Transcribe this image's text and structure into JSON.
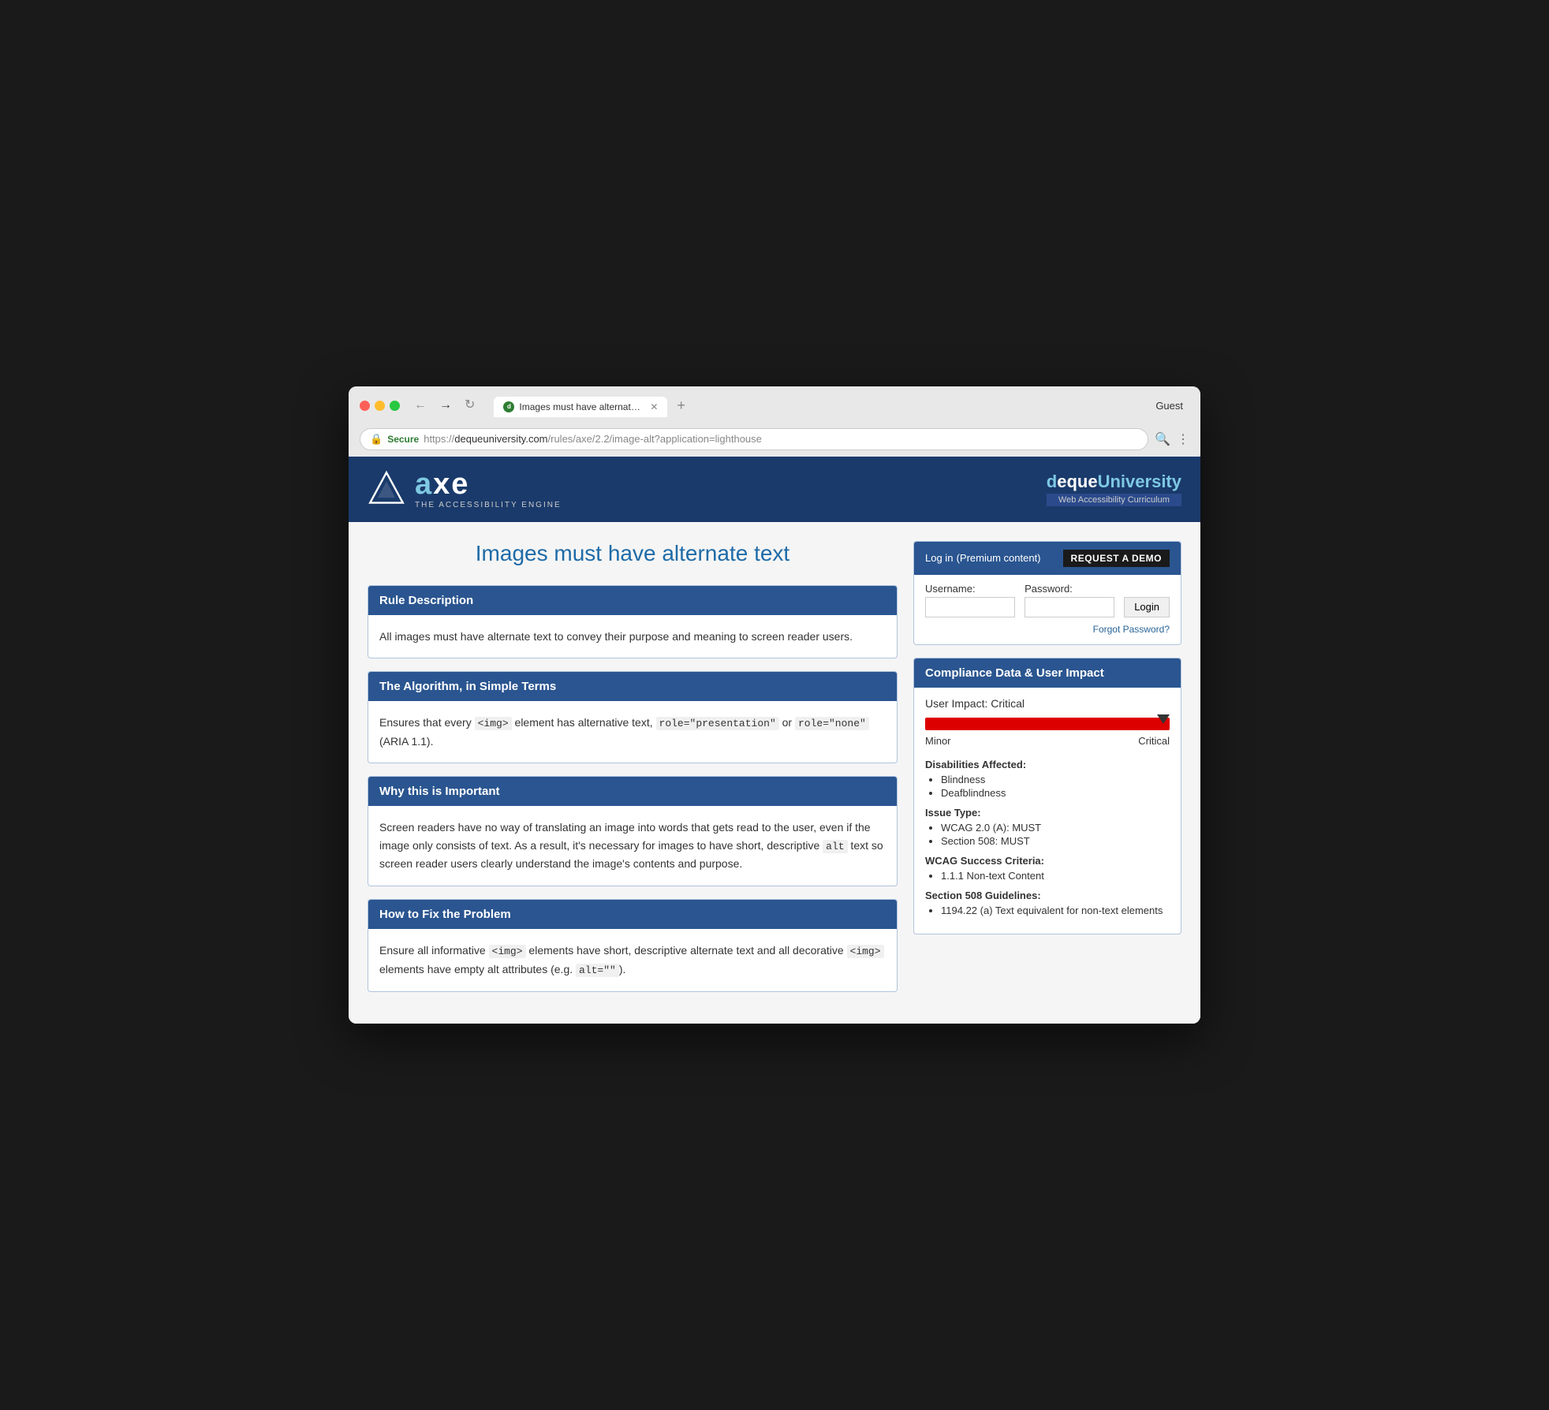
{
  "browser": {
    "guest_label": "Guest",
    "tab_title": "Images must have alternate te...",
    "favicon_letter": "d",
    "url_secure": "Secure",
    "url_full": "https://dequeuniversity.com/rules/axe/2.2/image-alt?application=lighthouse",
    "url_base": "dequeuniversity.com",
    "url_path": "/rules/axe/2.2/image-alt?application=lighthouse"
  },
  "header": {
    "logo_tagline": "THE ACCESSIBILITY ENGINE",
    "brand_name": "axe",
    "deque_name_pre": "d",
    "deque_name_em": "eque",
    "deque_university": "University",
    "deque_subtitle": "Web Accessibility Curriculum"
  },
  "page": {
    "title": "Images must have alternate text"
  },
  "login": {
    "title": "Log in",
    "title_sub": "(Premium content)",
    "request_demo": "REQUEST A DEMO",
    "username_label": "Username:",
    "password_label": "Password:",
    "login_button": "Login",
    "forgot_password": "Forgot Password?"
  },
  "sections": [
    {
      "id": "rule-description",
      "header": "Rule Description",
      "body": "All images must have alternate text to convey their purpose and meaning to screen reader users."
    },
    {
      "id": "algorithm",
      "header": "The Algorithm, in Simple Terms",
      "body_parts": [
        "Ensures that every ",
        "<img>",
        " element has alternative text, ",
        "role=\"presentation\"",
        " or ",
        "role=\"none\"",
        " (ARIA 1.1)."
      ]
    },
    {
      "id": "why-important",
      "header": "Why this is Important",
      "body": "Screen readers have no way of translating an image into words that gets read to the user, even if the image only consists of text. As a result, it's necessary for images to have short, descriptive alt text so screen reader users clearly understand the image's contents and purpose."
    },
    {
      "id": "how-to-fix",
      "header": "How to Fix the Problem",
      "body_parts": [
        "Ensure all informative ",
        "<img>",
        " elements have short, descriptive alternate text and all decorative ",
        "<img>",
        " elements have empty alt attributes (e.g. ",
        "alt=\"\"",
        ")."
      ]
    }
  ],
  "compliance": {
    "panel_title": "Compliance Data & User Impact",
    "user_impact_label": "User Impact:",
    "user_impact_value": "Critical",
    "scale_min": "Minor",
    "scale_max": "Critical",
    "disabilities_title": "Disabilities Affected:",
    "disabilities": [
      "Blindness",
      "Deafblindness"
    ],
    "issue_type_title": "Issue Type:",
    "issue_types": [
      "WCAG 2.0 (A): MUST",
      "Section 508: MUST"
    ],
    "wcag_title": "WCAG Success Criteria:",
    "wcag_items": [
      "1.1.1 Non-text Content"
    ],
    "section508_title": "Section 508 Guidelines:",
    "section508_items": [
      "1194.22 (a) Text equivalent for non-text elements"
    ]
  }
}
